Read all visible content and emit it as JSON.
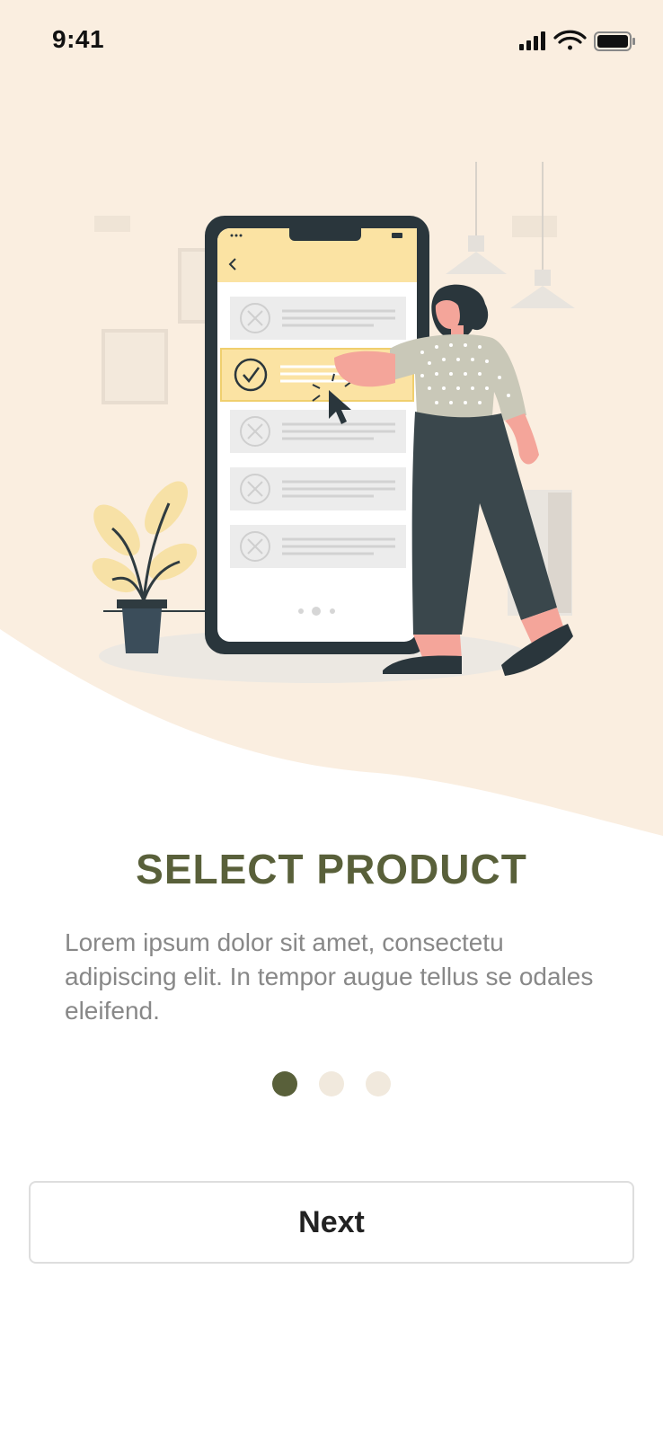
{
  "status_bar": {
    "time": "9:41",
    "icons": [
      "cellular-signal-icon",
      "wifi-icon",
      "battery-icon"
    ]
  },
  "illustration": {
    "name": "select-product-illustration",
    "items": [
      "unchecked-item",
      "checked-item",
      "unchecked-item",
      "unchecked-item",
      "unchecked-item"
    ]
  },
  "onboarding": {
    "title": "SELECT PRODUCT",
    "description": "Lorem ipsum dolor sit amet, consectetu adipiscing elit. In tempor augue tellus se odales eleifend.",
    "page_indicator": {
      "total": 3,
      "current": 1
    },
    "next_label": "Next"
  },
  "colors": {
    "accent": "#59603a",
    "hero_background": "#faeee0",
    "dot_inactive": "#f1e9dd",
    "highlight": "#fbe3a3"
  }
}
